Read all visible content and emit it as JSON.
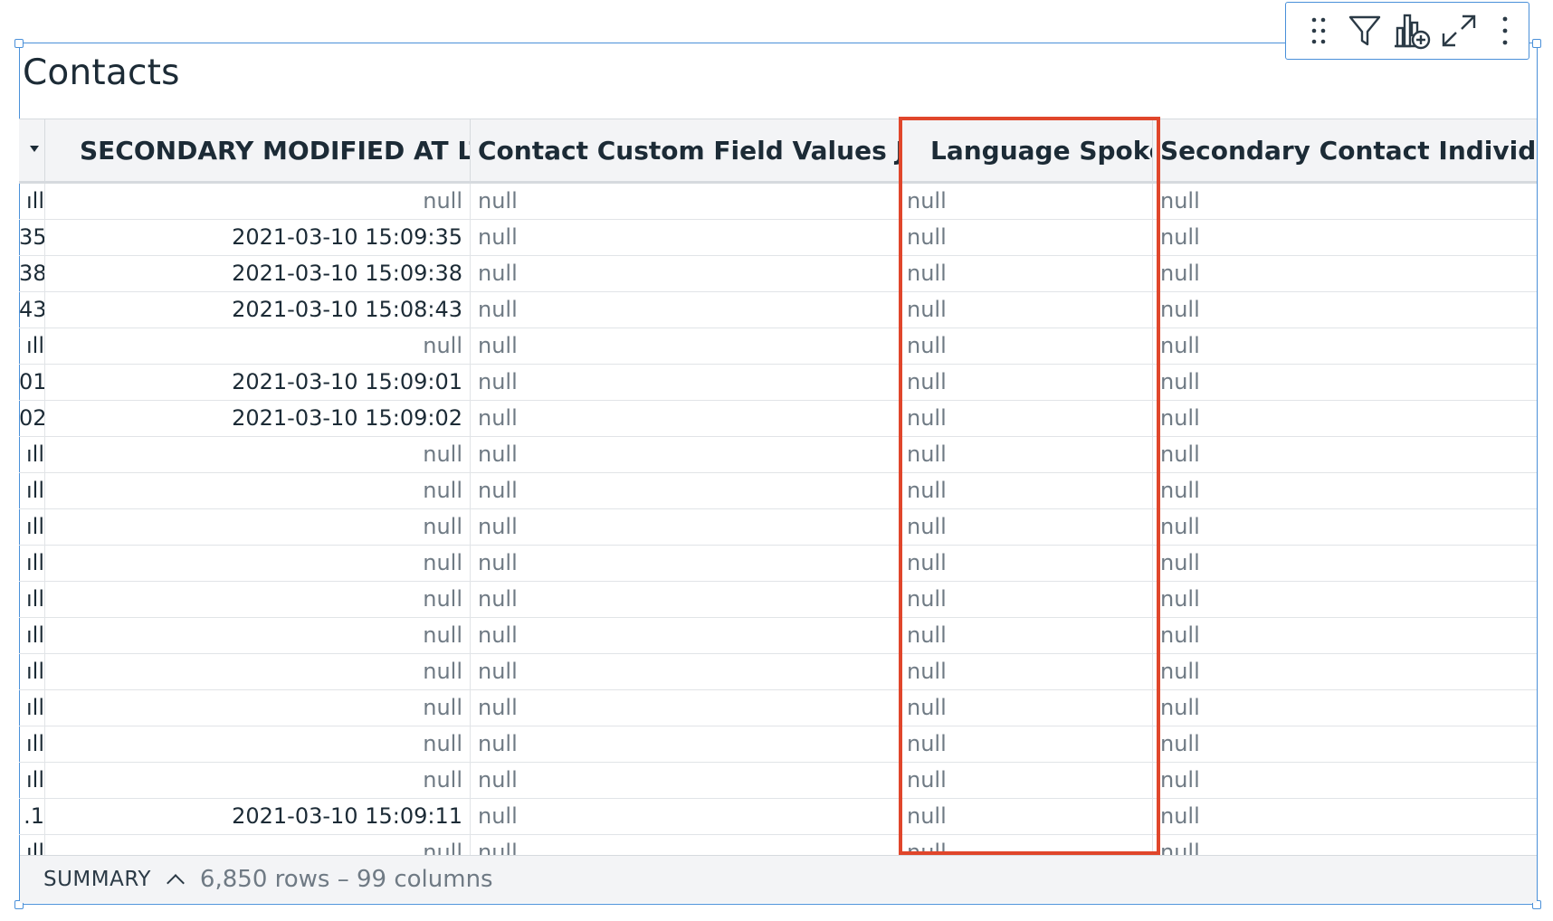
{
  "widget": {
    "title": "Contacts"
  },
  "toolbar": {
    "icons": [
      "drag-handle-icon",
      "filter-icon",
      "add-chart-icon",
      "expand-icon",
      "more-vert-icon"
    ]
  },
  "table": {
    "columns": [
      {
        "label": "SECONDARY MODIFIED AT LTZ"
      },
      {
        "label": "Contact Custom Field Values Json"
      },
      {
        "label": "Language Spoken"
      },
      {
        "label": "Secondary Contact Individual Cus"
      }
    ],
    "rows": [
      {
        "clip": "ıll",
        "modified": "null",
        "json": "null",
        "lang": "null",
        "sec": "null"
      },
      {
        "clip": "35",
        "modified": "2021-03-10 15:09:35",
        "json": "null",
        "lang": "null",
        "sec": "null"
      },
      {
        "clip": "38",
        "modified": "2021-03-10 15:09:38",
        "json": "null",
        "lang": "null",
        "sec": "null"
      },
      {
        "clip": "43",
        "modified": "2021-03-10 15:08:43",
        "json": "null",
        "lang": "null",
        "sec": "null"
      },
      {
        "clip": "ıll",
        "modified": "null",
        "json": "null",
        "lang": "null",
        "sec": "null"
      },
      {
        "clip": "01",
        "modified": "2021-03-10 15:09:01",
        "json": "null",
        "lang": "null",
        "sec": "null"
      },
      {
        "clip": "02",
        "modified": "2021-03-10 15:09:02",
        "json": "null",
        "lang": "null",
        "sec": "null"
      },
      {
        "clip": "ıll",
        "modified": "null",
        "json": "null",
        "lang": "null",
        "sec": "null"
      },
      {
        "clip": "ıll",
        "modified": "null",
        "json": "null",
        "lang": "null",
        "sec": "null"
      },
      {
        "clip": "ıll",
        "modified": "null",
        "json": "null",
        "lang": "null",
        "sec": "null"
      },
      {
        "clip": "ıll",
        "modified": "null",
        "json": "null",
        "lang": "null",
        "sec": "null"
      },
      {
        "clip": "ıll",
        "modified": "null",
        "json": "null",
        "lang": "null",
        "sec": "null"
      },
      {
        "clip": "ıll",
        "modified": "null",
        "json": "null",
        "lang": "null",
        "sec": "null"
      },
      {
        "clip": "ıll",
        "modified": "null",
        "json": "null",
        "lang": "null",
        "sec": "null"
      },
      {
        "clip": "ıll",
        "modified": "null",
        "json": "null",
        "lang": "null",
        "sec": "null"
      },
      {
        "clip": "ıll",
        "modified": "null",
        "json": "null",
        "lang": "null",
        "sec": "null"
      },
      {
        "clip": "ıll",
        "modified": "null",
        "json": "null",
        "lang": "null",
        "sec": "null"
      },
      {
        "clip": ".1",
        "modified": "2021-03-10 15:09:11",
        "json": "null",
        "lang": "null",
        "sec": "null"
      },
      {
        "clip": "ıll",
        "modified": "null",
        "json": "null",
        "lang": "null",
        "sec": "null"
      }
    ]
  },
  "footer": {
    "summary_label": "SUMMARY",
    "count_text": "6,850 rows – 99 columns"
  },
  "colors": {
    "accent": "#4a90d9",
    "highlight": "#e0462b"
  }
}
